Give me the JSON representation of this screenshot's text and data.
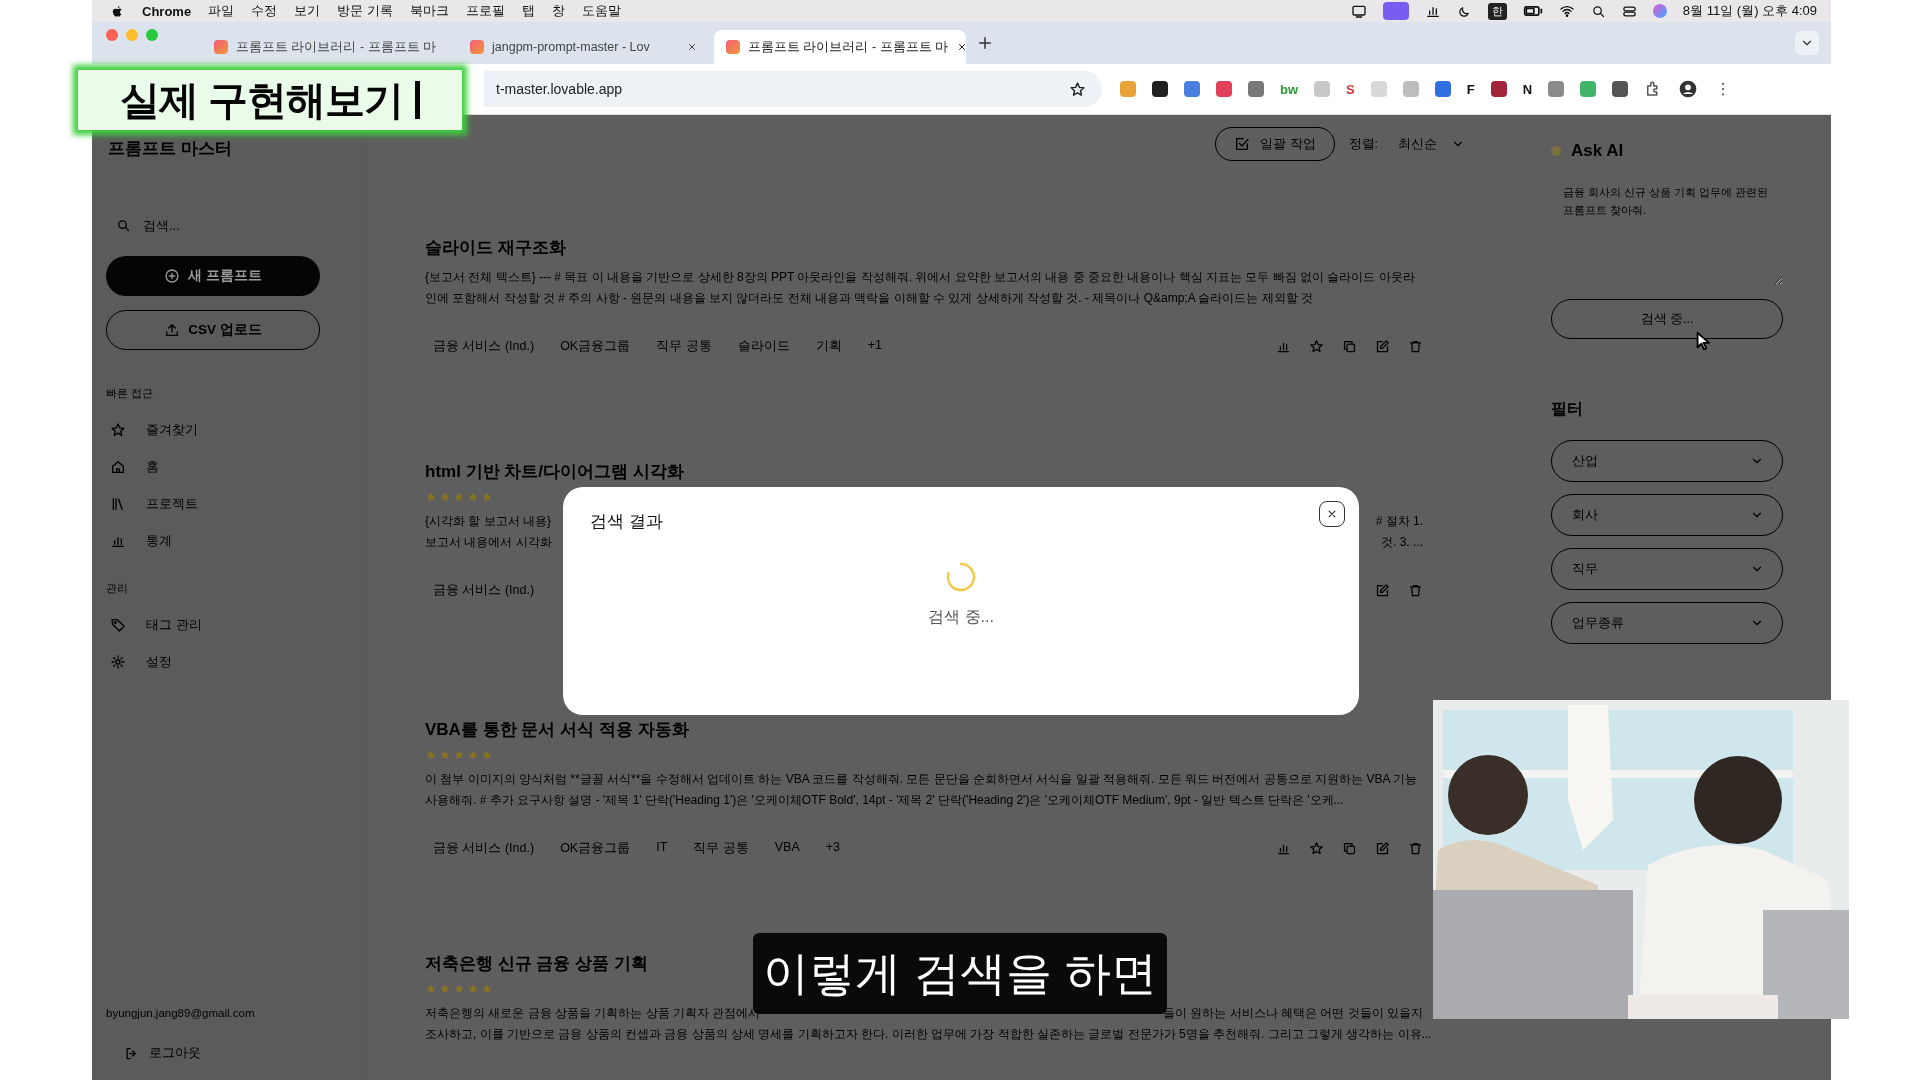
{
  "menu_bar": {
    "app": "Chrome",
    "menus": [
      "파일",
      "수정",
      "보기",
      "방문 기록",
      "북마크",
      "프로필",
      "탭",
      "창",
      "도움말"
    ],
    "input_source": "한",
    "clock": "8월 11일 (월) 오후 4:09"
  },
  "browser": {
    "tabs": [
      {
        "label": "프롬프트 라이브러리 - 프롬프트 마",
        "selected": false
      },
      {
        "label": "jangpm-prompt-master - Lov",
        "selected": false
      },
      {
        "label": "프롬프트 라이브러리 - 프롬프트 마",
        "selected": true
      }
    ],
    "address": "t-master.lovable.app",
    "extensions": [
      {
        "kind": "dot",
        "color": "#e8a33a"
      },
      {
        "kind": "dot",
        "color": "#222222"
      },
      {
        "kind": "dot",
        "color": "#4a7fe0"
      },
      {
        "kind": "dot",
        "color": "#e0405a"
      },
      {
        "kind": "dot",
        "color": "#777777"
      },
      {
        "kind": "letter",
        "text": "bw",
        "color": "#2a9a3a"
      },
      {
        "kind": "dot",
        "color": "#c8c8c8"
      },
      {
        "kind": "letter",
        "text": "S",
        "color": "#d23a3a"
      },
      {
        "kind": "dot",
        "color": "#d8d8d8"
      },
      {
        "kind": "dot",
        "color": "#bdbdbd"
      },
      {
        "kind": "dot",
        "color": "#2f6fe0"
      },
      {
        "kind": "letter",
        "text": "F",
        "color": "#111111"
      },
      {
        "kind": "dot",
        "color": "#a0243a"
      },
      {
        "kind": "letter",
        "text": "N",
        "color": "#111111"
      },
      {
        "kind": "dot",
        "color": "#8a8a8a"
      },
      {
        "kind": "dot",
        "color": "#3fb46a"
      },
      {
        "kind": "dot",
        "color": "#555555"
      }
    ]
  },
  "overlay_title": {
    "text": "실제 구현해보기"
  },
  "sidebar": {
    "title": "프롬프트 마스터",
    "search": {
      "placeholder": "검색..."
    },
    "buttons": [
      {
        "label": "새 프롬프트",
        "kind": "primary"
      },
      {
        "label": "CSV 업로드",
        "kind": "outline"
      }
    ],
    "sections": [
      {
        "heading": "빠른 접근",
        "items": [
          {
            "label": "즐겨찾기",
            "kind": "favorites"
          },
          {
            "label": "홈",
            "kind": "home"
          },
          {
            "label": "프로젝트",
            "kind": "projects"
          },
          {
            "label": "통계",
            "kind": "stats"
          }
        ]
      },
      {
        "heading": "관리",
        "items": [
          {
            "label": "태그 관리",
            "kind": "tags"
          },
          {
            "label": "설정",
            "kind": "settings"
          }
        ]
      }
    ],
    "email": "byungjun.jang89@gmail.com",
    "logout": "로그아웃"
  },
  "main": {
    "toolbar": {
      "bulk_button": "일괄 작업",
      "sort_label": "정렬:",
      "sort_value": "최신순"
    },
    "cards": [
      {
        "title": "슬라이드 재구조화",
        "lines": [
          [
            "{보고서 전체 텍스트} --- # 목표 이 내용을 기반으로 상세한 8장의 PPT 아웃라인을 작성해줘. 위에서 요약한 보고서의 내용 중 중요한 내용이나 핵심 지표는 모두 빠짐 없이 슬라이드 아웃라"
          ],
          [
            "인에 포함해서 작성할 것 # 주의 사항 - 원문의 내용을 보지 않더라도 전체 내용과 맥락을 이해할 수 있게 상세하게 작성할 것. - 제목이나 Q&amp;A 슬라이드는 제외할 것"
          ]
        ],
        "tags": [
          "금융 서비스 (Ind.)",
          "OK금융그룹",
          "직무 공통",
          "슬라이드",
          "기획",
          "+1"
        ]
      },
      {
        "title": "html 기반 차트/다이어그램 시각화",
        "stars": 5,
        "lines": [
          [
            "{시각화 할 보고서 내용}",
            "# 절차 1."
          ],
          [
            "보고서 내용에서 시각화",
            "것. 3. ..."
          ]
        ],
        "tags": [
          "금융 서비스 (Ind.)"
        ]
      },
      {
        "title": "VBA를 통한 문서 서식 적용 자동화",
        "stars": 5,
        "lines": [
          [
            "이 첨부 이미지의 양식처럼 **글꼴 서식**을 수정해서 업데이트 하는 VBA 코드를 작성해줘. 모든 문단을 순회하면서 서식을 일괄 적용해줘. 모든 워드 버전에서 공통으로 지원하는 VBA 기능"
          ],
          [
            "사용해줘. # 추가 요구사항 설명 - '제목 1' 단락('Heading 1')은 '오케이체OTF Bold', 14pt - '제목 2' 단락('Heading 2')은 '오케이체OTF Medium', 9pt - 일반 텍스트 단락은 '오케..."
          ]
        ],
        "tags": [
          "금융 서비스 (Ind.)",
          "OK금융그룹",
          "IT",
          "직무 공통",
          "VBA",
          "+3"
        ]
      },
      {
        "title": "저축은행 신규 금융 상품 기획",
        "stars": 5,
        "lines": [
          [
            "저축은행의 새로운 금융 상품을 기획하는 상품 기획자 관점에서",
            "들이 원하는 서비스나 혜택은 어떤 것들이 있을지"
          ],
          [
            "조사하고, 이를 기반으로 금융 상품의 컨셉과 금융 상품의 상세 명세를 기획하고자 한다. 이러한 업무에 가장 적합한 실존하는 글로벌 전문가가 5명을 추천해줘. 그리고 그렇게 생각하는 이유..."
          ]
        ]
      }
    ]
  },
  "ask_ai": {
    "title": "Ask AI",
    "query": "금융 회사의 신규 상품 기획 업무에 관련된 프롬프트 찾아줘.",
    "button": "검색 중..."
  },
  "filters": {
    "title": "필터",
    "dropdowns": [
      "산업",
      "회사",
      "직무",
      "업무종류"
    ]
  },
  "modal": {
    "title": "검색 결과",
    "status": "검색 중..."
  },
  "caption": {
    "text": "이렇게 검색을 하면"
  }
}
